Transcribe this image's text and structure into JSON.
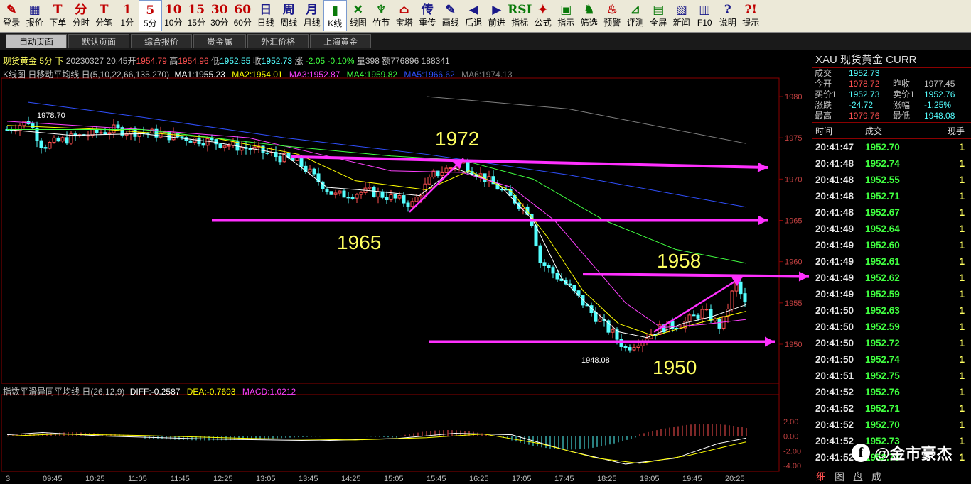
{
  "toolbar": [
    {
      "icon": "✎",
      "label": "登录",
      "cls": "red"
    },
    {
      "icon": "▦",
      "label": "报价",
      "cls": ""
    },
    {
      "icon": "T",
      "label": "下单",
      "cls": "red"
    },
    {
      "icon": "分",
      "label": "分时",
      "cls": "red"
    },
    {
      "icon": "T",
      "label": "分笔",
      "cls": "red"
    },
    {
      "icon": "1",
      "label": "1分",
      "cls": "red"
    },
    {
      "icon": "5",
      "label": "5分",
      "cls": "red"
    },
    {
      "icon": "10",
      "label": "10分",
      "cls": "red"
    },
    {
      "icon": "15",
      "label": "15分",
      "cls": "red"
    },
    {
      "icon": "30",
      "label": "30分",
      "cls": "red"
    },
    {
      "icon": "60",
      "label": "60分",
      "cls": "red"
    },
    {
      "icon": "日",
      "label": "日线",
      "cls": ""
    },
    {
      "icon": "周",
      "label": "周线",
      "cls": ""
    },
    {
      "icon": "月",
      "label": "月线",
      "cls": ""
    },
    {
      "icon": "▮",
      "label": "K线",
      "cls": "grn"
    },
    {
      "icon": "✕",
      "label": "线图",
      "cls": "grn"
    },
    {
      "icon": "♆",
      "label": "竹节",
      "cls": "grn"
    },
    {
      "icon": "⌂",
      "label": "宝塔",
      "cls": "red"
    },
    {
      "icon": "传",
      "label": "重传",
      "cls": ""
    },
    {
      "icon": "✎",
      "label": "画线",
      "cls": ""
    },
    {
      "icon": "◀",
      "label": "后退",
      "cls": ""
    },
    {
      "icon": "▶",
      "label": "前进",
      "cls": ""
    },
    {
      "icon": "RSI",
      "label": "指标",
      "cls": "grn"
    },
    {
      "icon": "✦",
      "label": "公式",
      "cls": "red"
    },
    {
      "icon": "▣",
      "label": "指示",
      "cls": "grn"
    },
    {
      "icon": "♞",
      "label": "筛选",
      "cls": "grn"
    },
    {
      "icon": "♨",
      "label": "预警",
      "cls": "red"
    },
    {
      "icon": "⊿",
      "label": "评测",
      "cls": "grn"
    },
    {
      "icon": "▤",
      "label": "全屏",
      "cls": "grn"
    },
    {
      "icon": "▧",
      "label": "新闻",
      "cls": ""
    },
    {
      "icon": "▥",
      "label": "F10",
      "cls": ""
    },
    {
      "icon": "?",
      "label": "说明",
      "cls": ""
    },
    {
      "icon": "?!",
      "label": "提示",
      "cls": "red"
    }
  ],
  "tabs": [
    "自动页面",
    "默认页面",
    "综合报价",
    "贵金属",
    "外汇价格",
    "上海黄金"
  ],
  "info": {
    "name": "现货黄金 5分 下",
    "date": "20230327 20:45",
    "open_l": "开",
    "open": "1954.79",
    "high_l": "高",
    "high": "1954.96",
    "low_l": "低",
    "low": "1952.55",
    "close_l": "收",
    "close": "1952.73",
    "chg_l": "涨",
    "chg": "-2.05 -0.10%",
    "vol": "量398 额776896 188341"
  },
  "ma_line": {
    "label": "K线图 日移动平均线 日(5,10,22,66,135,270)",
    "ma1": "MA1:1955.23",
    "ma2": "MA2:1954.01",
    "ma3": "MA3:1952.87",
    "ma4": "MA4:1959.82",
    "ma5": "MA5:1966.62",
    "ma6": "MA6:1974.13"
  },
  "macd_line": {
    "label": "指数平滑异同平均线 日(26,12,9)",
    "diff": "DIFF:-0.2587",
    "dea": "DEA:-0.7693",
    "macd": "MACD:1.0212"
  },
  "price_axis": [
    "1980",
    "1975",
    "1970",
    "1965",
    "1960",
    "1955",
    "1950"
  ],
  "macd_axis": [
    "2.00",
    "0.00",
    "-2.00",
    "-4.00"
  ],
  "time_axis": [
    "3",
    "09:45",
    "10:25",
    "11:05",
    "11:45",
    "12:25",
    "13:05",
    "13:45",
    "14:25",
    "15:05",
    "15:45",
    "16:25",
    "17:05",
    "17:45",
    "18:25",
    "19:05",
    "19:45",
    "20:25"
  ],
  "annotations": {
    "a1972": "1972",
    "a1965": "1965",
    "a1958": "1958",
    "a1950": "1950",
    "hi": "1978.70",
    "lo": "1948.08"
  },
  "panel": {
    "title": "XAU  现货黄金    CURR",
    "rows": [
      {
        "l1": "成交",
        "v1": "1952.73",
        "l2": "",
        "v2": ""
      },
      {
        "l1": "今开",
        "v1": "1978.72",
        "l2": "昨收",
        "v2": "1977.45"
      },
      {
        "l1": "买价1",
        "v1": "1952.73",
        "l2": "卖价1",
        "v2": "1952.76"
      },
      {
        "l1": "涨跌",
        "v1": "-24.72",
        "l2": "涨幅",
        "v2": "-1.25%"
      },
      {
        "l1": "最高",
        "v1": "1979.76",
        "l2": "最低",
        "v2": "1948.08"
      }
    ],
    "tick_head": [
      "时间",
      "成交",
      "现手"
    ],
    "ticks": [
      [
        "20:41:47",
        "1952.70",
        "1"
      ],
      [
        "20:41:48",
        "1952.74",
        "1"
      ],
      [
        "20:41:48",
        "1952.55",
        "1"
      ],
      [
        "20:41:48",
        "1952.71",
        "1"
      ],
      [
        "20:41:48",
        "1952.67",
        "1"
      ],
      [
        "20:41:49",
        "1952.64",
        "1"
      ],
      [
        "20:41:49",
        "1952.60",
        "1"
      ],
      [
        "20:41:49",
        "1952.61",
        "1"
      ],
      [
        "20:41:49",
        "1952.62",
        "1"
      ],
      [
        "20:41:49",
        "1952.59",
        "1"
      ],
      [
        "20:41:50",
        "1952.63",
        "1"
      ],
      [
        "20:41:50",
        "1952.59",
        "1"
      ],
      [
        "20:41:50",
        "1952.72",
        "1"
      ],
      [
        "20:41:50",
        "1952.74",
        "1"
      ],
      [
        "20:41:51",
        "1952.75",
        "1"
      ],
      [
        "20:41:52",
        "1952.76",
        "1"
      ],
      [
        "20:41:52",
        "1952.71",
        "1"
      ],
      [
        "20:41:52",
        "1952.70",
        "1"
      ],
      [
        "20:41:52",
        "1952.73",
        "1"
      ],
      [
        "20:41:52",
        "1952.73",
        "1"
      ]
    ],
    "bottom": [
      "细",
      "图",
      "盘",
      "成"
    ]
  },
  "watermark": "@金市豪杰",
  "colors": {
    "up": "#ff5050",
    "down": "#54ffff",
    "ma1": "#ffffff",
    "ma2": "#ffff00",
    "ma3": "#ff40ff",
    "ma4": "#40ff40",
    "ma5": "#3050ff",
    "ma6": "#808080",
    "arrow": "#ff30ff",
    "label": "#ffff60"
  }
}
